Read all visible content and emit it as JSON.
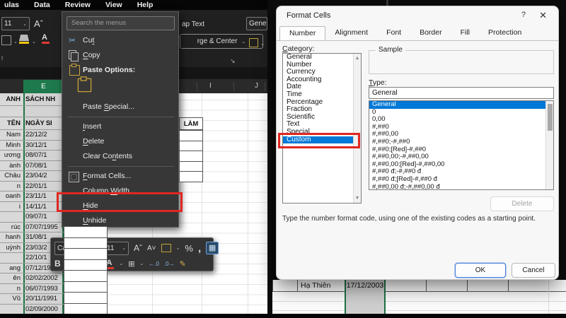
{
  "colors": {
    "annotation_red": "#df2721",
    "selection_blue": "#0078d7",
    "excel_green": "#1e7145",
    "header_green": "#1e7a4c",
    "dark_bg": "#1f1f1f",
    "menu_bg": "#373737"
  },
  "left_excel": {
    "menu_bar": {
      "items": [
        "ulas",
        "Data",
        "Review",
        "View",
        "Help"
      ]
    },
    "ribbon": {
      "font_size": "11",
      "wrap_text": "ap Text",
      "merge_center": "rge & Center",
      "number_format": "Gener",
      "group_label": "t"
    },
    "context_menu": {
      "search_placeholder": "Search the menus",
      "items": [
        {
          "label": "Cut",
          "u": 2,
          "icon": "scissors"
        },
        {
          "label": "Copy",
          "u": 0,
          "icon": "copy"
        },
        {
          "label": "Paste Options:",
          "bold": 1,
          "icon": "clipboard"
        },
        {
          "label": "",
          "icon": "clipboard-large",
          "paste_row": 1
        },
        {
          "label": "Paste Special...",
          "u": 6
        },
        {
          "sep": 1
        },
        {
          "label": "Insert",
          "u": 0
        },
        {
          "label": "Delete",
          "u": 0
        },
        {
          "label": "Clear Contents",
          "u": 8
        },
        {
          "sep": 1
        },
        {
          "label": "Format Cells...",
          "u": 0,
          "icon": "format-cells"
        },
        {
          "label": "Column Width...",
          "u": 7,
          "boxed": 1
        },
        {
          "label": "Hide",
          "u": 0
        },
        {
          "label": "Unhide",
          "u": 0
        }
      ]
    },
    "mini_toolbar": {
      "font_name": "Calibri",
      "font_size": "11",
      "row1_icons": [
        "grow-font",
        "shrink-font",
        "accounting-format",
        "percent-style",
        "comma-style",
        "cell-styles"
      ],
      "percent": "%",
      "comma": ",",
      "bold": "B",
      "italic": "I"
    },
    "sheet": {
      "visible_col_headers": [
        "E",
        "I",
        "J"
      ],
      "title_name_part": "ANH",
      "title_date_part": "SÁCH NH",
      "header_name": "TÊN",
      "header_date": "NGÀY SI",
      "lam_label": "LÀM",
      "rows": [
        {
          "n": "Nam",
          "d": "22/12/2"
        },
        {
          "n": "Minh",
          "d": "30/12/1"
        },
        {
          "n": "ương",
          "d": "08/07/1"
        },
        {
          "n": "ành",
          "d": "07/08/1"
        },
        {
          "n": "Châu",
          "d": "23/04/2"
        },
        {
          "n": "n",
          "d": "22/01/1"
        },
        {
          "n": "oanh",
          "d": "23/11/1"
        },
        {
          "n": "i",
          "d": "14/11/1"
        },
        {
          "n": "",
          "d": "09/07/1"
        },
        {
          "n": "rúc",
          "d": "07/07/1995"
        },
        {
          "n": "hanh",
          "d": "31/08/1"
        },
        {
          "n": "uỳnh",
          "d": "23/03/2"
        },
        {
          "n": "",
          "d": "22/10/1"
        },
        {
          "n": "ang",
          "d": "07/12/1998"
        },
        {
          "n": "ên",
          "d": "02/02/2002"
        },
        {
          "n": "n",
          "d": "06/07/1993"
        },
        {
          "n": "Vũ",
          "d": "20/11/1991"
        },
        {
          "n": "",
          "d": "02/09/2000"
        }
      ]
    }
  },
  "format_cells_dialog": {
    "title": "Format Cells",
    "help_glyph": "?",
    "close_glyph": "✕",
    "tabs": [
      "Number",
      "Alignment",
      "Font",
      "Border",
      "Fill",
      "Protection"
    ],
    "selected_tab": "Number",
    "category_label": "Category:",
    "categories": [
      "General",
      "Number",
      "Currency",
      "Accounting",
      "Date",
      "Time",
      "Percentage",
      "Fraction",
      "Scientific",
      "Text",
      "Special",
      "Custom"
    ],
    "selected_category": "Custom",
    "sample_label": "Sample",
    "type_label": "Type:",
    "type_value": "General",
    "type_codes": [
      "General",
      "0",
      "0,00",
      "#,##0",
      "#,##0,00",
      "#,##0;-#,##0",
      "#,##0;[Red]-#,##0",
      "#,##0,00;-#,##0,00",
      "#,##0,00;[Red]-#,##0,00",
      "#,##0 đ;-#,##0 đ",
      "#,##0 đ;[Red]-#,##0 đ",
      "#,##0,00 đ;-#,##0,00 đ"
    ],
    "selected_type_code": "General",
    "delete_label": "Delete",
    "instruction": "Type the number format code, using one of the existing codes as a starting point.",
    "ok_label": "OK",
    "cancel_label": "Cancel"
  },
  "sheet_below_dialog": {
    "name_cell": "Hạ Thiên",
    "date_cell": "17/12/2003"
  }
}
